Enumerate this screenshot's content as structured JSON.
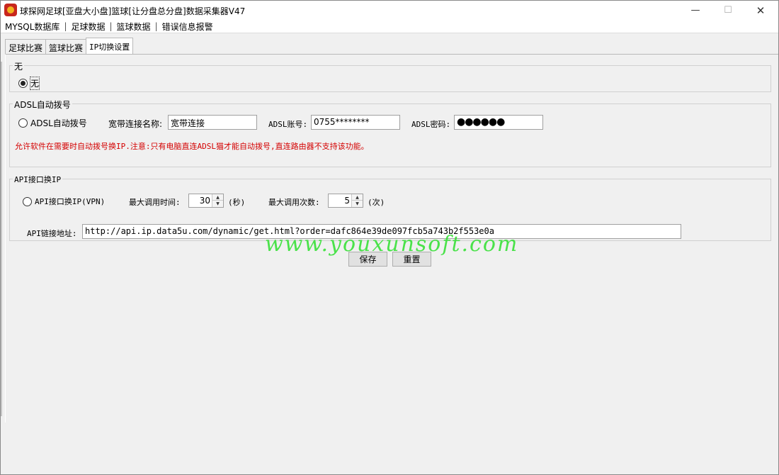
{
  "window": {
    "title": "球探网足球[亚盘大小盘]篮球[让分盘总分盘]数据采集器V47",
    "min_glyph": "—",
    "max_glyph": "☐",
    "close_glyph": "✕"
  },
  "menu": {
    "items": [
      "MYSQL数据库",
      "足球数据",
      "篮球数据",
      "错误信息报警"
    ],
    "separator": "|"
  },
  "tabs": [
    {
      "label": "足球比赛",
      "active": false
    },
    {
      "label": "篮球比赛",
      "active": false
    },
    {
      "label": "IP切换设置",
      "active": true
    }
  ],
  "none_group": {
    "title": "无",
    "radio_label": "无",
    "checked": true
  },
  "adsl_group": {
    "title": "ADSL自动拨号",
    "radio_label": "ADSL自动拨号",
    "checked": false,
    "conn_name_label": "宽带连接名称:",
    "conn_name_value": "宽带连接",
    "account_label": "ADSL账号:",
    "account_value": "0755********",
    "password_label": "ADSL密码:",
    "password_value": "●●●●●●",
    "note": "允许软件在需要时自动拨号换IP.注意:只有电脑直连ADSL猫才能自动拨号,直连路由器不支持该功能。"
  },
  "api_group": {
    "title": "API接口换IP",
    "radio_label": "API接口换IP(VPN)",
    "checked": false,
    "max_time_label": "最大调用时间:",
    "max_time_value": "30",
    "max_time_unit": "(秒)",
    "max_count_label": "最大调用次数:",
    "max_count_value": "5",
    "max_count_unit": "(次)",
    "url_label": "API链接地址:",
    "url_value": "http://api.ip.data5u.com/dynamic/get.html?order=dafc864e39de097fcb5a743b2f553e0a"
  },
  "buttons": {
    "save": "保存",
    "reset": "重置"
  },
  "watermark": "www.youxunsoft.com"
}
